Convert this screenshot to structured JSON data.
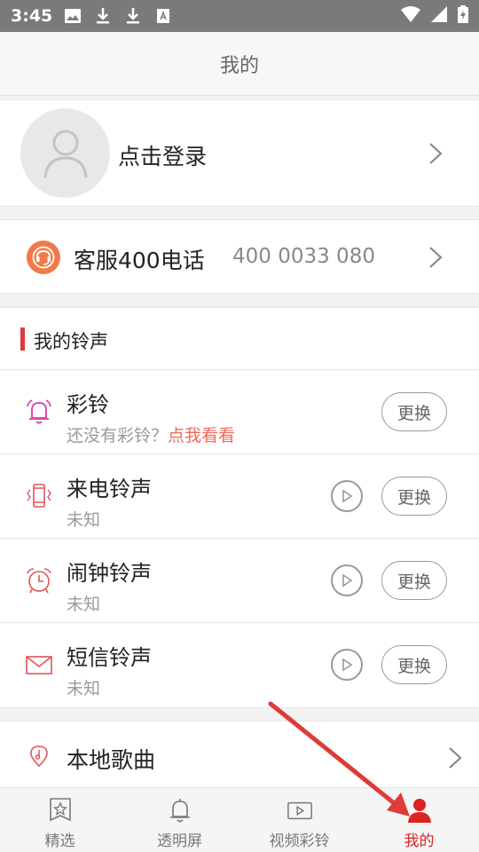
{
  "status": {
    "time": "3:45"
  },
  "header": {
    "title": "我的"
  },
  "profile": {
    "login_text": "点击登录"
  },
  "service": {
    "label": "客服400电话",
    "number": "400 0033 080"
  },
  "ringtones": {
    "section_title": "我的铃声",
    "change_label": "更换",
    "items": [
      {
        "title": "彩铃",
        "sub": "还没有彩铃？",
        "sub_link": "点我看看",
        "icon": "bell-icon"
      },
      {
        "title": "来电铃声",
        "sub": "未知",
        "icon": "phone-vibrate-icon"
      },
      {
        "title": "闹钟铃声",
        "sub": "未知",
        "icon": "alarm-clock-icon"
      },
      {
        "title": "短信铃声",
        "sub": "未知",
        "icon": "envelope-icon"
      }
    ]
  },
  "local": {
    "label": "本地歌曲"
  },
  "tabs": [
    {
      "label": "精选",
      "icon": "star-bookmark-icon"
    },
    {
      "label": "透明屏",
      "icon": "bell-outline-icon"
    },
    {
      "label": "视频彩铃",
      "icon": "video-icon"
    },
    {
      "label": "我的",
      "icon": "person-icon",
      "active": true
    }
  ],
  "colors": {
    "accent": "#e03a3a",
    "service_icon": "#ef7a4a",
    "link": "#ef6a5a",
    "active_tab": "#dd2222"
  }
}
